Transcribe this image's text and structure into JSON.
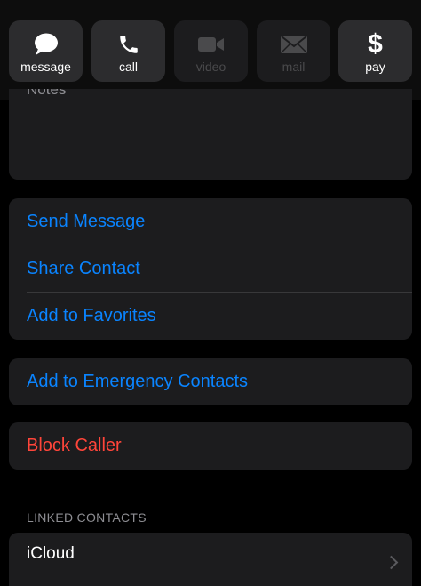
{
  "actions": [
    {
      "label": "message",
      "icon": "message-bubble-icon",
      "enabled": true
    },
    {
      "label": "call",
      "icon": "phone-icon",
      "enabled": true
    },
    {
      "label": "video",
      "icon": "video-camera-icon",
      "enabled": false
    },
    {
      "label": "mail",
      "icon": "mail-envelope-icon",
      "enabled": false
    },
    {
      "label": "pay",
      "icon": "dollar-icon",
      "enabled": true
    }
  ],
  "notes": {
    "label": "Notes"
  },
  "contact_actions": {
    "send_message": "Send Message",
    "share_contact": "Share Contact",
    "add_to_favorites": "Add to Favorites"
  },
  "emergency": {
    "label": "Add to Emergency Contacts"
  },
  "block": {
    "label": "Block Caller"
  },
  "linked_contacts": {
    "header": "LINKED CONTACTS",
    "items": [
      {
        "label": "iCloud"
      }
    ]
  },
  "colors": {
    "accent": "#0a84ff",
    "destructive": "#ff453a",
    "card": "#1c1c1e",
    "button": "#2c2c2e"
  }
}
